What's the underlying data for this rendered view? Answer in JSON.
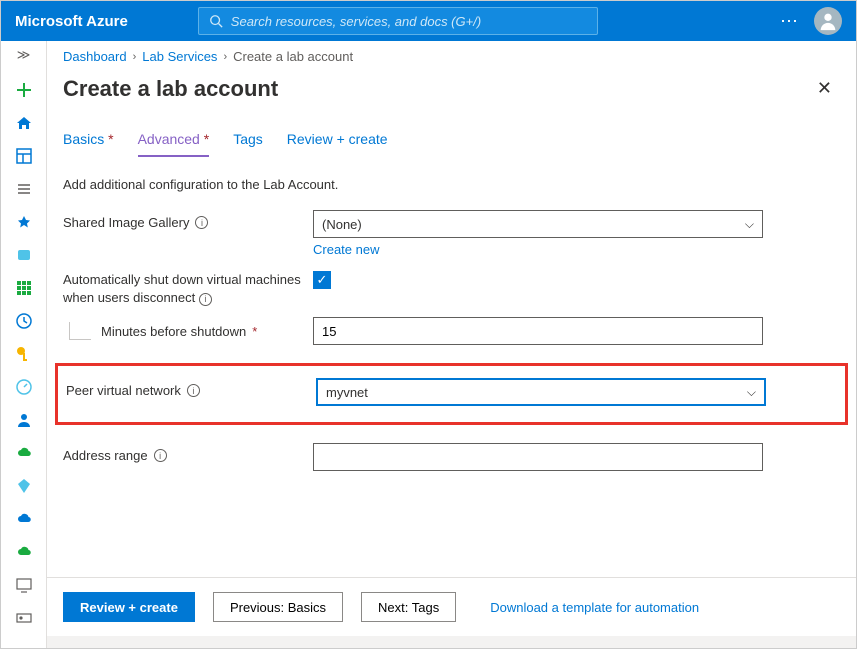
{
  "header": {
    "brand": "Microsoft Azure",
    "search_placeholder": "Search resources, services, and docs (G+/)"
  },
  "breadcrumbs": {
    "items": [
      "Dashboard",
      "Lab Services"
    ],
    "current": "Create a lab account"
  },
  "page": {
    "title": "Create a lab account"
  },
  "tabs": {
    "basics": "Basics",
    "advanced": "Advanced",
    "tags": "Tags",
    "review": "Review + create"
  },
  "form": {
    "description": "Add additional configuration to the Lab Account.",
    "shared_image_gallery_label": "Shared Image Gallery",
    "shared_image_gallery_value": "(None)",
    "create_new_link": "Create new",
    "auto_shutdown_label": "Automatically shut down virtual machines when users disconnect",
    "auto_shutdown_checked": true,
    "minutes_label": "Minutes before shutdown",
    "minutes_value": "15",
    "peer_vnet_label": "Peer virtual network",
    "peer_vnet_value": "myvnet",
    "address_range_label": "Address range",
    "address_range_value": ""
  },
  "footer": {
    "review": "Review + create",
    "previous": "Previous: Basics",
    "next": "Next: Tags",
    "download_link": "Download a template for automation"
  }
}
